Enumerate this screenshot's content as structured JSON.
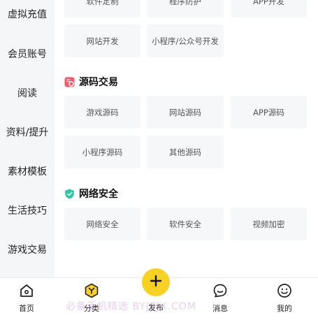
{
  "sidebar": {
    "items": [
      "虚拟充值",
      "会员账号",
      "阅读",
      "资料/提升",
      "素材模板",
      "生活技巧",
      "游戏交易"
    ]
  },
  "top_partial": [
    "软件定制",
    "程序防护",
    "APP开发"
  ],
  "row_dev": [
    "网站开发",
    "小程序/公众号开发"
  ],
  "sections": [
    {
      "title": "源码交易",
      "icon": "code-source-icon",
      "color": "#f25a6b",
      "items": [
        "游戏源码",
        "网站源码",
        "APP源码",
        "小程序源码",
        "其他源码"
      ]
    },
    {
      "title": "网络安全",
      "icon": "shield-icon",
      "color": "#2dc7a6",
      "items": [
        "网络安全",
        "软件安全",
        "视频加密"
      ]
    }
  ],
  "tabbar": {
    "home": "首页",
    "category": "分类",
    "publish": "发布",
    "messages": "消息",
    "mine": "我的"
  },
  "watermark": "必备手机精选 BYJSJX.COM",
  "colors": {
    "accent": "#f8d223",
    "chip_bg": "#f6f7f8"
  }
}
